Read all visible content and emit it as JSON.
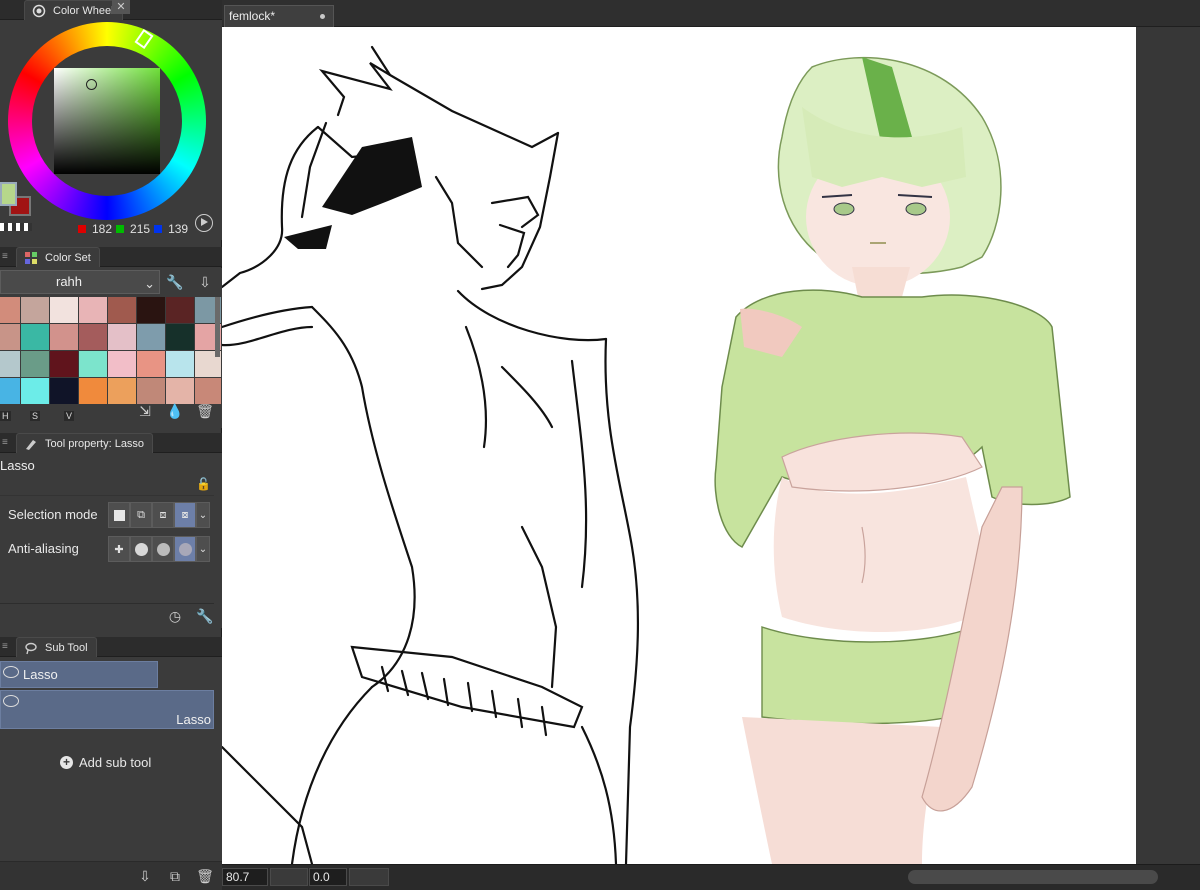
{
  "document": {
    "tab_title": "femlock*"
  },
  "color_wheel": {
    "panel_title": "Color Wheel",
    "rgb": {
      "r": "182",
      "g": "215",
      "b": "139"
    },
    "main_color": "#b6d78b",
    "sub_color": "#a11414"
  },
  "color_set": {
    "panel_title": "Color Set",
    "selected_set": "rahh",
    "swatches": [
      "#d28c7b",
      "#c4a59c",
      "#f2e2de",
      "#e8b4b6",
      "#a05a4e",
      "#2a1411",
      "#5a2424",
      "#7c98a4",
      "#c89488",
      "#3ab8a4",
      "#d2928c",
      "#a45c5c",
      "#e4c0c8",
      "#7e9cac",
      "#16302a",
      "#e4a4a4",
      "#b4c8cc",
      "#6a9c88",
      "#60141c",
      "#7ce4cc",
      "#f2bec8",
      "#e89484",
      "#b8e4ec",
      "#e8d8d0",
      "#48b4e4",
      "#6cece8",
      "#101428",
      "#f08a3c",
      "#eca05c",
      "#c08878",
      "#e4b4a8",
      "#c88878"
    ],
    "hsv_labels": [
      "H",
      "S",
      "V"
    ]
  },
  "tool_property": {
    "panel_title": "Tool property: Lasso",
    "tool_name": "Lasso",
    "selection_mode_label": "Selection mode",
    "anti_aliasing_label": "Anti-aliasing"
  },
  "sub_tool": {
    "panel_title": "Sub Tool",
    "items": [
      {
        "label": "Lasso"
      },
      {
        "label": "Lasso"
      }
    ],
    "add_label": "Add sub tool"
  },
  "status": {
    "zoom": "80.7",
    "rotation": "0.0"
  }
}
